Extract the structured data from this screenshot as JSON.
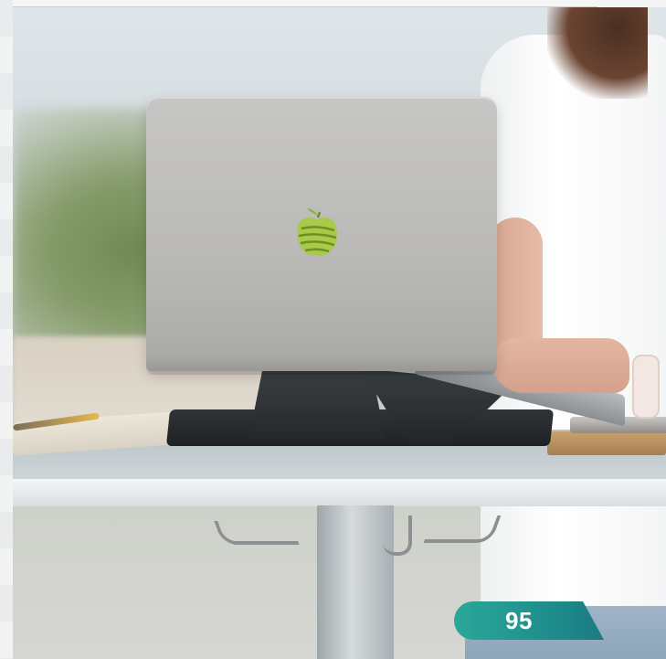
{
  "page": {
    "page_number": "95"
  },
  "photo": {
    "subject_icon": "apple-logo-icon",
    "colors": {
      "badge": "#1f8f8d",
      "logo_green": "#9bbf3a"
    }
  }
}
